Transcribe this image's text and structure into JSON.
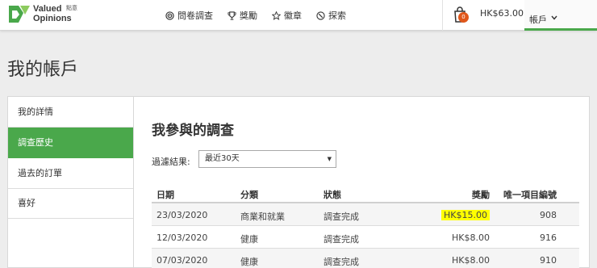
{
  "brand": {
    "name_line1": "Valued",
    "name_line2": "Opinions",
    "name_cn": "點意",
    "color": "#4aa84b"
  },
  "nav": {
    "items": [
      {
        "label": "問卷調查",
        "icon": "target-icon"
      },
      {
        "label": "獎勵",
        "icon": "trophy-icon"
      },
      {
        "label": "徽章",
        "icon": "star-icon"
      },
      {
        "label": "探索",
        "icon": "compass-icon"
      }
    ],
    "cart_count": "0",
    "balance": "HK$63.00",
    "account_label": "帳戶"
  },
  "page_title": "我的帳戶",
  "sidebar": {
    "items": [
      {
        "label": "我的詳情",
        "active": false
      },
      {
        "label": "調查歷史",
        "active": true
      },
      {
        "label": "過去的訂單",
        "active": false
      },
      {
        "label": "喜好",
        "active": false
      }
    ]
  },
  "main": {
    "title": "我參與的調查",
    "filter_label": "過濾結果:",
    "filter_value": "最近30天",
    "columns": [
      "日期",
      "分類",
      "狀態",
      "獎勵",
      "唯一項目編號"
    ],
    "rows": [
      {
        "date": "23/03/2020",
        "category": "商業和就業",
        "status": "調查完成",
        "reward": "HK$15.00",
        "id": "908",
        "highlight": true
      },
      {
        "date": "12/03/2020",
        "category": "健康",
        "status": "調查完成",
        "reward": "HK$8.00",
        "id": "916",
        "highlight": false
      },
      {
        "date": "07/03/2020",
        "category": "健康",
        "status": "調查完成",
        "reward": "HK$8.00",
        "id": "910",
        "highlight": false
      }
    ]
  },
  "colors": {
    "accent": "#4aa84b",
    "badge": "#e0571b",
    "highlight": "#ffff00"
  }
}
